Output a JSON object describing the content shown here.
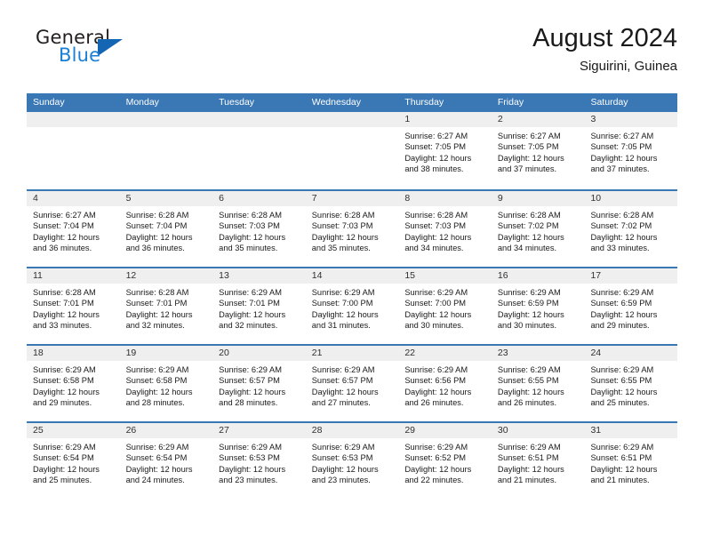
{
  "logo": {
    "word_one": "General",
    "word_two": "Blue",
    "triangle_icon": "blue-triangle-icon"
  },
  "header": {
    "title": "August 2024",
    "subtitle": "Siguirini, Guinea"
  },
  "colors": {
    "header_blue": "#3a77b5",
    "day_strip_gray": "#efefef",
    "logo_blue": "#1b7fd4",
    "text_dark": "#1a1a1a"
  },
  "calendar": {
    "weekdays": [
      "Sunday",
      "Monday",
      "Tuesday",
      "Wednesday",
      "Thursday",
      "Friday",
      "Saturday"
    ],
    "weeks": [
      [
        {
          "day": "",
          "lines": []
        },
        {
          "day": "",
          "lines": []
        },
        {
          "day": "",
          "lines": []
        },
        {
          "day": "",
          "lines": []
        },
        {
          "day": "1",
          "lines": [
            "Sunrise: 6:27 AM",
            "Sunset: 7:05 PM",
            "Daylight: 12 hours",
            "and 38 minutes."
          ]
        },
        {
          "day": "2",
          "lines": [
            "Sunrise: 6:27 AM",
            "Sunset: 7:05 PM",
            "Daylight: 12 hours",
            "and 37 minutes."
          ]
        },
        {
          "day": "3",
          "lines": [
            "Sunrise: 6:27 AM",
            "Sunset: 7:05 PM",
            "Daylight: 12 hours",
            "and 37 minutes."
          ]
        }
      ],
      [
        {
          "day": "4",
          "lines": [
            "Sunrise: 6:27 AM",
            "Sunset: 7:04 PM",
            "Daylight: 12 hours",
            "and 36 minutes."
          ]
        },
        {
          "day": "5",
          "lines": [
            "Sunrise: 6:28 AM",
            "Sunset: 7:04 PM",
            "Daylight: 12 hours",
            "and 36 minutes."
          ]
        },
        {
          "day": "6",
          "lines": [
            "Sunrise: 6:28 AM",
            "Sunset: 7:03 PM",
            "Daylight: 12 hours",
            "and 35 minutes."
          ]
        },
        {
          "day": "7",
          "lines": [
            "Sunrise: 6:28 AM",
            "Sunset: 7:03 PM",
            "Daylight: 12 hours",
            "and 35 minutes."
          ]
        },
        {
          "day": "8",
          "lines": [
            "Sunrise: 6:28 AM",
            "Sunset: 7:03 PM",
            "Daylight: 12 hours",
            "and 34 minutes."
          ]
        },
        {
          "day": "9",
          "lines": [
            "Sunrise: 6:28 AM",
            "Sunset: 7:02 PM",
            "Daylight: 12 hours",
            "and 34 minutes."
          ]
        },
        {
          "day": "10",
          "lines": [
            "Sunrise: 6:28 AM",
            "Sunset: 7:02 PM",
            "Daylight: 12 hours",
            "and 33 minutes."
          ]
        }
      ],
      [
        {
          "day": "11",
          "lines": [
            "Sunrise: 6:28 AM",
            "Sunset: 7:01 PM",
            "Daylight: 12 hours",
            "and 33 minutes."
          ]
        },
        {
          "day": "12",
          "lines": [
            "Sunrise: 6:28 AM",
            "Sunset: 7:01 PM",
            "Daylight: 12 hours",
            "and 32 minutes."
          ]
        },
        {
          "day": "13",
          "lines": [
            "Sunrise: 6:29 AM",
            "Sunset: 7:01 PM",
            "Daylight: 12 hours",
            "and 32 minutes."
          ]
        },
        {
          "day": "14",
          "lines": [
            "Sunrise: 6:29 AM",
            "Sunset: 7:00 PM",
            "Daylight: 12 hours",
            "and 31 minutes."
          ]
        },
        {
          "day": "15",
          "lines": [
            "Sunrise: 6:29 AM",
            "Sunset: 7:00 PM",
            "Daylight: 12 hours",
            "and 30 minutes."
          ]
        },
        {
          "day": "16",
          "lines": [
            "Sunrise: 6:29 AM",
            "Sunset: 6:59 PM",
            "Daylight: 12 hours",
            "and 30 minutes."
          ]
        },
        {
          "day": "17",
          "lines": [
            "Sunrise: 6:29 AM",
            "Sunset: 6:59 PM",
            "Daylight: 12 hours",
            "and 29 minutes."
          ]
        }
      ],
      [
        {
          "day": "18",
          "lines": [
            "Sunrise: 6:29 AM",
            "Sunset: 6:58 PM",
            "Daylight: 12 hours",
            "and 29 minutes."
          ]
        },
        {
          "day": "19",
          "lines": [
            "Sunrise: 6:29 AM",
            "Sunset: 6:58 PM",
            "Daylight: 12 hours",
            "and 28 minutes."
          ]
        },
        {
          "day": "20",
          "lines": [
            "Sunrise: 6:29 AM",
            "Sunset: 6:57 PM",
            "Daylight: 12 hours",
            "and 28 minutes."
          ]
        },
        {
          "day": "21",
          "lines": [
            "Sunrise: 6:29 AM",
            "Sunset: 6:57 PM",
            "Daylight: 12 hours",
            "and 27 minutes."
          ]
        },
        {
          "day": "22",
          "lines": [
            "Sunrise: 6:29 AM",
            "Sunset: 6:56 PM",
            "Daylight: 12 hours",
            "and 26 minutes."
          ]
        },
        {
          "day": "23",
          "lines": [
            "Sunrise: 6:29 AM",
            "Sunset: 6:55 PM",
            "Daylight: 12 hours",
            "and 26 minutes."
          ]
        },
        {
          "day": "24",
          "lines": [
            "Sunrise: 6:29 AM",
            "Sunset: 6:55 PM",
            "Daylight: 12 hours",
            "and 25 minutes."
          ]
        }
      ],
      [
        {
          "day": "25",
          "lines": [
            "Sunrise: 6:29 AM",
            "Sunset: 6:54 PM",
            "Daylight: 12 hours",
            "and 25 minutes."
          ]
        },
        {
          "day": "26",
          "lines": [
            "Sunrise: 6:29 AM",
            "Sunset: 6:54 PM",
            "Daylight: 12 hours",
            "and 24 minutes."
          ]
        },
        {
          "day": "27",
          "lines": [
            "Sunrise: 6:29 AM",
            "Sunset: 6:53 PM",
            "Daylight: 12 hours",
            "and 23 minutes."
          ]
        },
        {
          "day": "28",
          "lines": [
            "Sunrise: 6:29 AM",
            "Sunset: 6:53 PM",
            "Daylight: 12 hours",
            "and 23 minutes."
          ]
        },
        {
          "day": "29",
          "lines": [
            "Sunrise: 6:29 AM",
            "Sunset: 6:52 PM",
            "Daylight: 12 hours",
            "and 22 minutes."
          ]
        },
        {
          "day": "30",
          "lines": [
            "Sunrise: 6:29 AM",
            "Sunset: 6:51 PM",
            "Daylight: 12 hours",
            "and 21 minutes."
          ]
        },
        {
          "day": "31",
          "lines": [
            "Sunrise: 6:29 AM",
            "Sunset: 6:51 PM",
            "Daylight: 12 hours",
            "and 21 minutes."
          ]
        }
      ]
    ]
  }
}
